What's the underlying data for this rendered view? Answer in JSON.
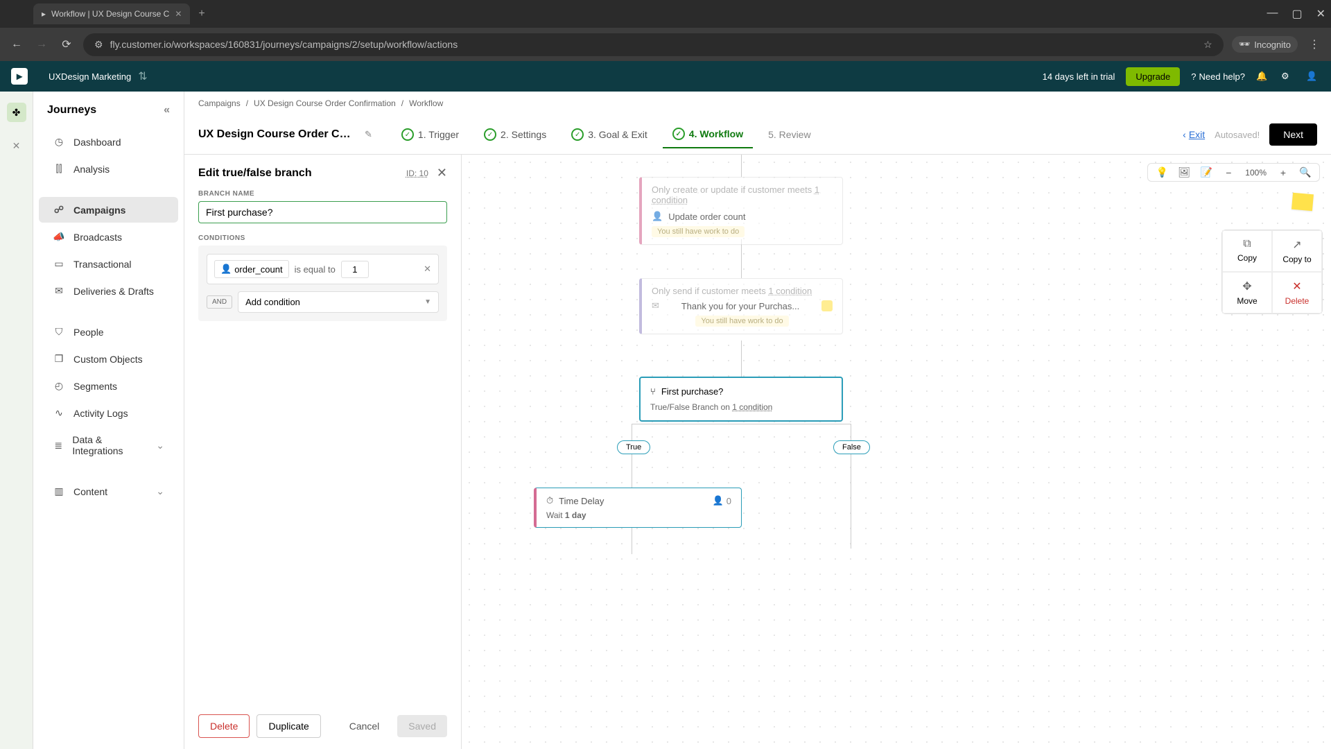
{
  "browser": {
    "tab_title": "Workflow | UX Design Course C",
    "url": "fly.customer.io/workspaces/160831/journeys/campaigns/2/setup/workflow/actions",
    "incognito": "Incognito"
  },
  "header": {
    "workspace": "UXDesign Marketing",
    "trial": "14 days left in trial",
    "upgrade": "Upgrade",
    "help": "Need help?"
  },
  "sidebar": {
    "title": "Journeys",
    "items": [
      {
        "icon": "◷",
        "label": "Dashboard"
      },
      {
        "icon": "⫿⫿",
        "label": "Analysis"
      },
      {
        "icon": "☍",
        "label": "Campaigns"
      },
      {
        "icon": "📣",
        "label": "Broadcasts"
      },
      {
        "icon": "▭",
        "label": "Transactional"
      },
      {
        "icon": "✉",
        "label": "Deliveries & Drafts"
      },
      {
        "icon": "⛉",
        "label": "People"
      },
      {
        "icon": "❒",
        "label": "Custom Objects"
      },
      {
        "icon": "◴",
        "label": "Segments"
      },
      {
        "icon": "∿",
        "label": "Activity Logs"
      },
      {
        "icon": "≣",
        "label": "Data & Integrations"
      },
      {
        "icon": "▥",
        "label": "Content"
      }
    ]
  },
  "breadcrumb": {
    "a": "Campaigns",
    "b": "UX Design Course Order Confirmation",
    "c": "Workflow"
  },
  "stepper": {
    "campaign": "UX Design Course Order Confir...",
    "steps": [
      "1. Trigger",
      "2. Settings",
      "3. Goal & Exit",
      "4. Workflow",
      "5. Review"
    ],
    "exit": "Exit",
    "autosaved": "Autosaved!",
    "next": "Next"
  },
  "inspector": {
    "title": "Edit true/false branch",
    "id": "ID: 10",
    "branch_name_label": "BRANCH NAME",
    "branch_name_value": "First purchase?",
    "conditions_label": "CONDITIONS",
    "attr": "order_count",
    "op": "is equal to",
    "val": "1",
    "and": "AND",
    "add_condition": "Add condition",
    "delete": "Delete",
    "duplicate": "Duplicate",
    "cancel": "Cancel",
    "saved": "Saved"
  },
  "canvas": {
    "zoom": "100%",
    "node1_line1": "Only create or update if customer meets",
    "node1_cond": "1 condition",
    "node1_action": "Update order count",
    "node1_work": "You still have work to do",
    "node2_line": "Only send if customer meets",
    "node2_cond": "1 condition",
    "node2_action": "Thank you for your Purchas...",
    "node2_work": "You still have work to do",
    "node3_title": "First purchase?",
    "node3_sub_a": "True/False Branch on",
    "node3_sub_b": "1 condition",
    "true_label": "True",
    "false_label": "False",
    "node4_title": "Time Delay",
    "node4_count": "0",
    "node4_sub_a": "Wait",
    "node4_sub_b": "1 day"
  },
  "palette": {
    "copy": "Copy",
    "copyto": "Copy to",
    "move": "Move",
    "delete": "Delete"
  }
}
